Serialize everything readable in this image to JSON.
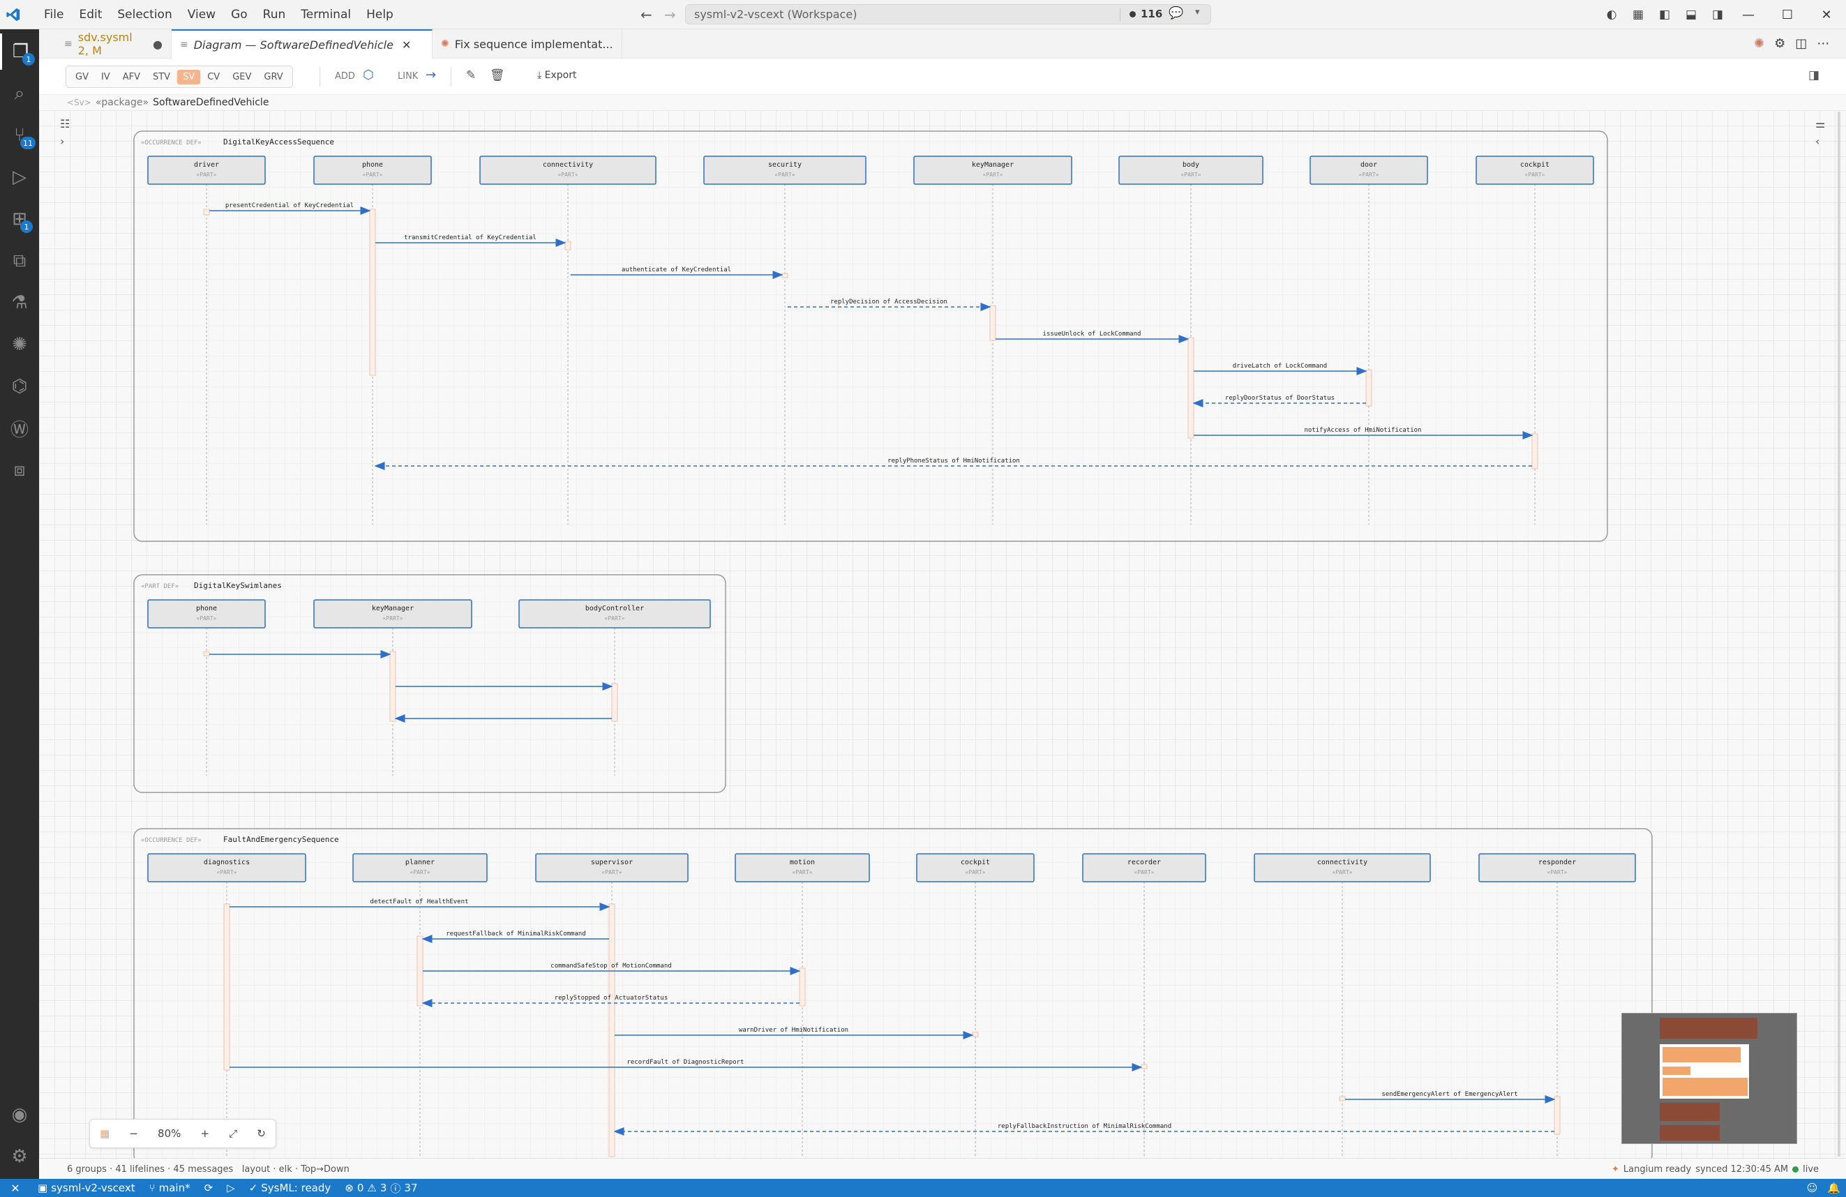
{
  "titlebar": {
    "menus": [
      "File",
      "Edit",
      "Selection",
      "View",
      "Go",
      "Run",
      "Terminal",
      "Help"
    ],
    "search_text": "sysml-v2-vscext (Workspace)",
    "changes_count": "116"
  },
  "activity": {
    "badges": {
      "explorer": "1",
      "source_control": "11",
      "extensions": "1"
    }
  },
  "tabs": [
    {
      "label": "sdv.sysml 2, M",
      "icon": "file-icon"
    },
    {
      "label": "Diagram — SoftwareDefinedVehicle",
      "icon": "preview-icon"
    },
    {
      "label": "Fix sequence implementat...",
      "icon": "claude-icon"
    }
  ],
  "toolbar": {
    "viewpoints": [
      "GV",
      "IV",
      "AFV",
      "STV",
      "SV",
      "CV",
      "GEV",
      "GRV"
    ],
    "selected_viewpoint": "SV",
    "add_label": "ADD",
    "link_label": "LINK",
    "export_label": "Export"
  },
  "breadcrumb": {
    "faint": "<Sv>",
    "keyword": "«package»",
    "name": "SoftwareDefinedVehicle"
  },
  "diagram": {
    "groups": [
      {
        "stereo": "«OCCURRENCE DEF»",
        "name": "DigitalKeyAccessSequence",
        "lifelines": [
          "driver",
          "phone",
          "connectivity",
          "security",
          "keyManager",
          "body",
          "door",
          "cockpit"
        ],
        "messages": [
          {
            "label": "presentCredential of KeyCredential"
          },
          {
            "label": "transmitCredential of KeyCredential"
          },
          {
            "label": "authenticate of KeyCredential"
          },
          {
            "label": "replyDecision of AccessDecision"
          },
          {
            "label": "issueUnlock of LockCommand"
          },
          {
            "label": "driveLatch of LockCommand"
          },
          {
            "label": "replyDoorStatus of DoorStatus"
          },
          {
            "label": "notifyAccess of HmiNotification"
          },
          {
            "label": "replyPhoneStatus of HmiNotification"
          }
        ]
      },
      {
        "stereo": "«PART DEF»",
        "name": "DigitalKeySwimlanes",
        "lifelines": [
          "phone",
          "keyManager",
          "bodyController"
        ],
        "messages": [
          {
            "label": ""
          },
          {
            "label": ""
          },
          {
            "label": ""
          }
        ]
      },
      {
        "stereo": "«OCCURRENCE DEF»",
        "name": "FaultAndEmergencySequence",
        "lifelines": [
          "diagnostics",
          "planner",
          "supervisor",
          "motion",
          "cockpit",
          "recorder",
          "connectivity",
          "responder"
        ],
        "messages": [
          {
            "label": "detectFault of HealthEvent"
          },
          {
            "label": "requestFallback of MinimalRiskCommand"
          },
          {
            "label": "commandSafeStop of MotionCommand"
          },
          {
            "label": "replyStopped of ActuatorStatus"
          },
          {
            "label": "warnDriver of HmiNotification"
          },
          {
            "label": "recordFault of DiagnosticReport"
          },
          {
            "label": "sendEmergencyAlert of EmergencyAlert"
          },
          {
            "label": "replyFallbackInstruction of MinimalRiskCommand"
          }
        ]
      }
    ],
    "part_stereo": "«PART»"
  },
  "zoom": {
    "level": "80%"
  },
  "info": {
    "stats": "6 groups · 41 lifelines · 45 messages",
    "layout": "layout · elk · Top→Down",
    "langium": "Langium ready",
    "synced": "synced 12:30:45 AM",
    "live": "live"
  },
  "status": {
    "remote": "sysml-v2-vscext",
    "branch": "main*",
    "sysml": "SysML: ready",
    "errors": "0",
    "warnings": "3",
    "infos": "37"
  }
}
